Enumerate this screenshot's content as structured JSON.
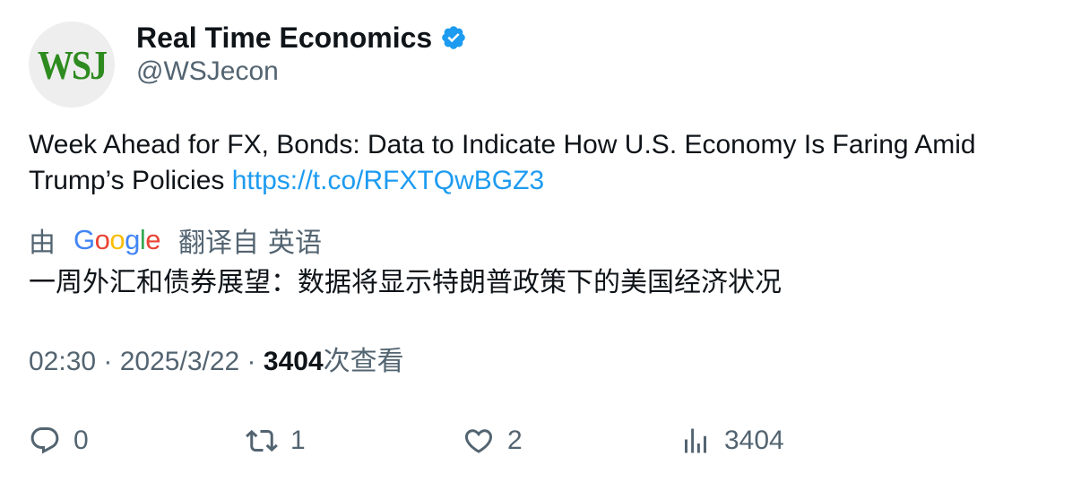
{
  "author": {
    "avatar_text": "WSJ",
    "display_name": "Real Time Economics",
    "handle": "@WSJecon",
    "verified_icon": "verified-badge-icon",
    "verified_color": "#1d9bf0",
    "avatar_text_color": "#2e8b1f"
  },
  "tweet": {
    "text": "Week Ahead for FX, Bonds: Data to Indicate How U.S. Economy Is Faring Amid Trump’s Policies ",
    "link": "https://t.co/RFXTQwBGZ3",
    "link_color": "#1d9bf0"
  },
  "translation": {
    "by_label": "由",
    "provider_letters": [
      "G",
      "o",
      "o",
      "g",
      "l",
      "e"
    ],
    "provider_colors": [
      "#4285F4",
      "#EA4335",
      "#FBBC05",
      "#4285F4",
      "#34A853",
      "#EA4335"
    ],
    "translated_from_label": "翻译自",
    "source_language": "英语",
    "translated_text": "一周外汇和债券展望：数据将显示特朗普政策下的美国经济状况"
  },
  "meta": {
    "time": "02:30",
    "separator": " · ",
    "date": "2025/3/22",
    "views_count": "3404",
    "views_label": "次查看"
  },
  "actions": {
    "reply": {
      "icon": "reply-icon",
      "count": "0"
    },
    "retweet": {
      "icon": "retweet-icon",
      "count": "1"
    },
    "like": {
      "icon": "heart-icon",
      "count": "2"
    },
    "views": {
      "icon": "analytics-icon",
      "count": "3404"
    }
  }
}
